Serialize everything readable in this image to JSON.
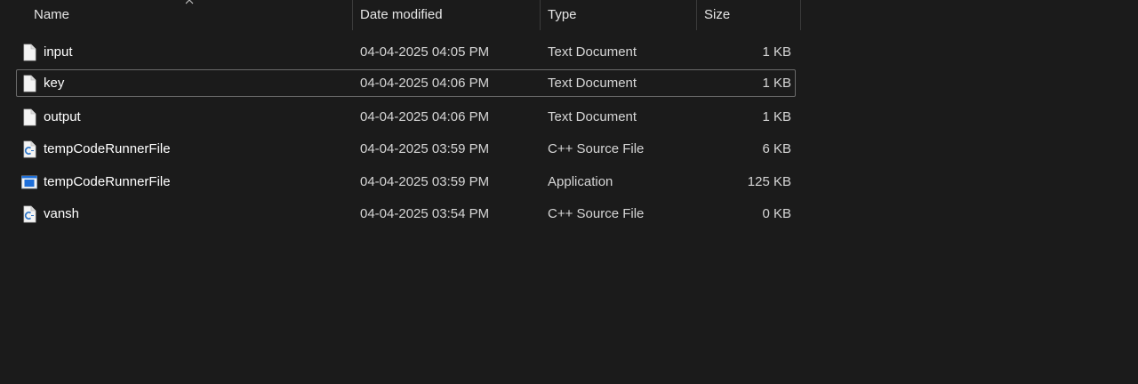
{
  "columns": {
    "name": "Name",
    "date": "Date modified",
    "type": "Type",
    "size": "Size"
  },
  "sort": {
    "column": "Name",
    "indicator": "caret-up-icon"
  },
  "files": [
    {
      "name": "input",
      "date": "04-04-2025 04:05 PM",
      "type": "Text Document",
      "size": "1 KB",
      "icon": "text-file-icon"
    },
    {
      "name": "key",
      "date": "04-04-2025 04:06 PM",
      "type": "Text Document",
      "size": "1 KB",
      "icon": "text-file-icon",
      "focused": true
    },
    {
      "name": "output",
      "date": "04-04-2025 04:06 PM",
      "type": "Text Document",
      "size": "1 KB",
      "icon": "text-file-icon"
    },
    {
      "name": "tempCodeRunnerFile",
      "date": "04-04-2025 03:59 PM",
      "type": "C++ Source File",
      "size": "6 KB",
      "icon": "cpp-file-icon"
    },
    {
      "name": "tempCodeRunnerFile",
      "date": "04-04-2025 03:59 PM",
      "type": "Application",
      "size": "125 KB",
      "icon": "application-icon"
    },
    {
      "name": "vansh",
      "date": "04-04-2025 03:54 PM",
      "type": "C++ Source File",
      "size": "0 KB",
      "icon": "cpp-file-icon"
    }
  ],
  "colors": {
    "background": "#1b1b1b",
    "focus_border": "#6a6a6a",
    "cpp_accent": "#2f77c8",
    "app_accent": "#1e6fd9"
  }
}
